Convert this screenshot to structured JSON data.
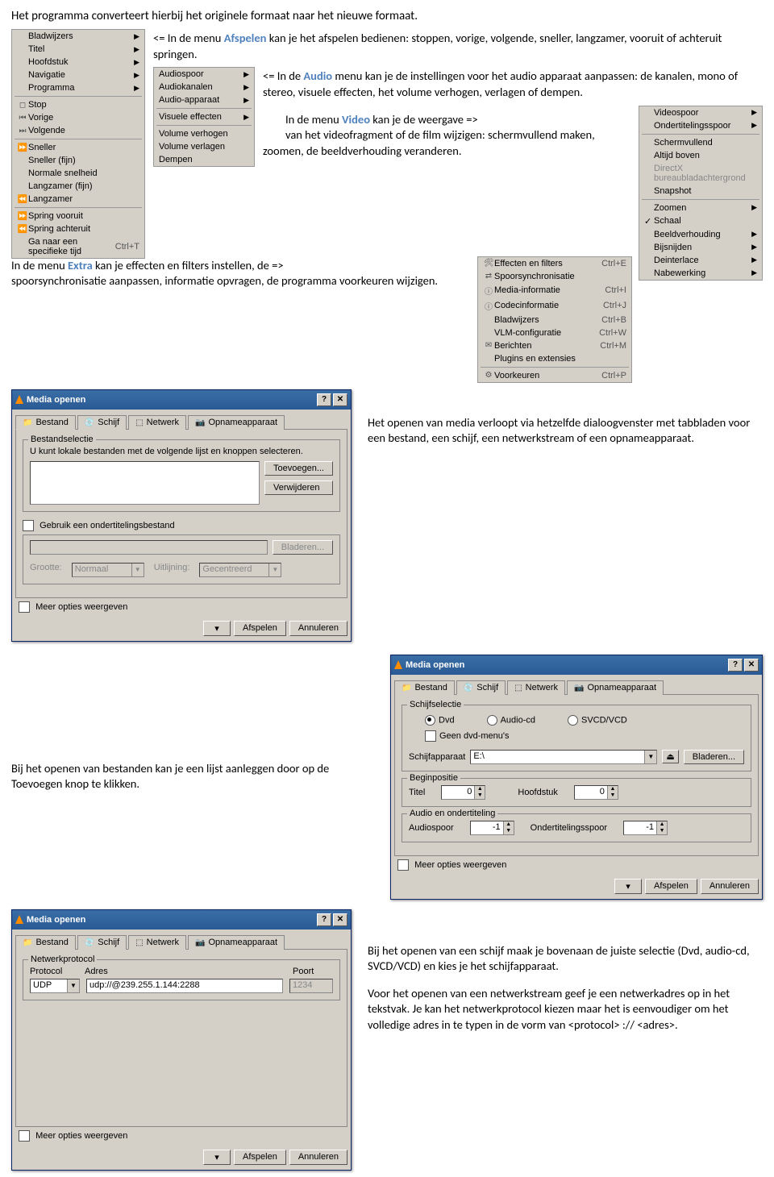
{
  "intro_para": "Het programma converteert hierbij het originele formaat naar het nieuwe formaat.",
  "afspelen_para_pre": "<= In de menu ",
  "afspelen_label": "Afspelen",
  "afspelen_para_post": " kan je het afspelen bedienen: stoppen, vorige, volgende, sneller, langzamer, vooruit of achteruit springen.",
  "audio_para_pre": "<= In de ",
  "audio_label": "Audio",
  "audio_para_post": " menu kan je de instellingen voor het audio apparaat aanpassen: de kanalen, mono of stereo, visuele effecten, het volume verhogen, verlagen of dempen.",
  "video_para_a": "In de menu ",
  "video_label": "Video",
  "video_para_b": " kan je de weergave   =>",
  "video_para_c": "van het videofragment of de film wijzigen: schermvullend maken, zoomen, de beeldverhouding veranderen.",
  "extra_para_a": "In de menu ",
  "extra_label": "Extra",
  "extra_para_b": " kan je effecten en filters instellen, de   =>",
  "extra_para_c": "spoorsynchronisatie aanpassen, informatie opvragen, de programma voorkeuren wijzigen.",
  "openen_para": "Het openen van media verloopt via hetzelfde dialoogvenster met tabbladen voor een bestand, een schijf, een netwerkstream of een opnameapparaat.",
  "lijst_para": "Bij het openen van bestanden kan je een lijst aanleggen door op de Toevoegen knop te klikken.",
  "schijf_para": "Bij het openen van een schijf maak je bovenaan de juiste selectie (Dvd, audio-cd, SVCD/VCD) en kies je het schijfapparaat.",
  "netwerk_para": "Voor het openen van een netwerkstream geef je een netwerkadres op in het tekstvak. Je kan het netwerkprotocol kiezen maar het is eenvoudiger om het volledige adres in te typen in de vorm van <protocol> :// <adres>.",
  "menu_afspelen": {
    "items_top": [
      "Bladwijzers",
      "Titel",
      "Hoofdstuk",
      "Navigatie",
      "Programma"
    ],
    "items_mid": [
      "Stop",
      "Vorige",
      "Volgende"
    ],
    "items_speed": [
      "Sneller",
      "Sneller (fijn)",
      "Normale snelheid",
      "Langzamer (fijn)",
      "Langzamer"
    ],
    "items_jump": [
      "Spring vooruit",
      "Spring achteruit",
      "Ga naar een specifieke tijd"
    ],
    "shortcut_goto": "Ctrl+T"
  },
  "menu_audio": {
    "items_top": [
      "Audiospoor",
      "Audiokanalen",
      "Audio-apparaat"
    ],
    "visuele": "Visuele effecten",
    "items_bot": [
      "Volume verhogen",
      "Volume verlagen",
      "Dempen"
    ]
  },
  "menu_video": {
    "items_top": [
      "Videospoor",
      "Ondertitelingsspoor"
    ],
    "items_mid": [
      "Schermvullend",
      "Altijd boven",
      "DirectX bureaubladachtergrond",
      "Snapshot"
    ],
    "items_bot": [
      "Zoomen",
      "Schaal",
      "Beeldverhouding",
      "Bijsnijden",
      "Deinterlace",
      "Nabewerking"
    ],
    "checked": "Schaal"
  },
  "menu_extra": {
    "rows": [
      {
        "icon": "🛠",
        "label": "Effecten en filters",
        "sc": "Ctrl+E"
      },
      {
        "icon": "⇄",
        "label": "Spoorsynchronisatie",
        "sc": ""
      },
      {
        "icon": "ⓘ",
        "label": "Media-informatie",
        "sc": "Ctrl+I"
      },
      {
        "icon": "ⓘ",
        "label": "Codecinformatie",
        "sc": "Ctrl+J"
      },
      {
        "icon": "",
        "label": "Bladwijzers",
        "sc": "Ctrl+B"
      },
      {
        "icon": "",
        "label": "VLM-configuratie",
        "sc": "Ctrl+W"
      },
      {
        "icon": "✉",
        "label": "Berichten",
        "sc": "Ctrl+M"
      },
      {
        "icon": "",
        "label": "Plugins en extensies",
        "sc": ""
      }
    ],
    "voorkeuren": {
      "icon": "⚙",
      "label": "Voorkeuren",
      "sc": "Ctrl+P"
    }
  },
  "dlg": {
    "title": "Media openen",
    "tabs": [
      "Bestand",
      "Schijf",
      "Netwerk",
      "Opnameapparaat"
    ],
    "bestand": {
      "grp": "Bestandselectie",
      "note": "U kunt lokale bestanden met de volgende lijst en knoppen selecteren.",
      "toevoegen": "Toevoegen...",
      "verwijderen": "Verwijderen",
      "sub_chk": "Gebruik een ondertitelingsbestand",
      "bladeren": "Bladeren...",
      "grootte": "Grootte:",
      "grootte_v": "Normaal",
      "uitlijning": "Uitlijning:",
      "uitlijning_v": "Gecentreerd"
    },
    "meer": "Meer opties weergeven",
    "afspelen": "Afspelen",
    "annuleren": "Annuleren",
    "schijf": {
      "grp": "Schijfselectie",
      "dvd": "Dvd",
      "acd": "Audio-cd",
      "svcd": "SVCD/VCD",
      "nomenu": "Geen dvd-menu's",
      "apparaat": "Schijfapparaat",
      "apparaat_v": "E:\\",
      "bladeren": "Bladeren...",
      "begin": "Beginpositie",
      "titel": "Titel",
      "titel_v": "0",
      "hoofdstuk": "Hoofdstuk",
      "hoofdstuk_v": "0",
      "audio_grp": "Audio en ondertiteling",
      "audiospoor": "Audiospoor",
      "audiospoor_v": "-1",
      "ondert": "Ondertitelingsspoor",
      "ondert_v": "-1"
    },
    "netwerk": {
      "grp": "Netwerkprotocol",
      "protocol": "Protocol",
      "adres": "Adres",
      "poort": "Poort",
      "protocol_v": "UDP",
      "adres_v": "udp://@239.255.1.144:2288",
      "poort_v": "1234"
    }
  }
}
